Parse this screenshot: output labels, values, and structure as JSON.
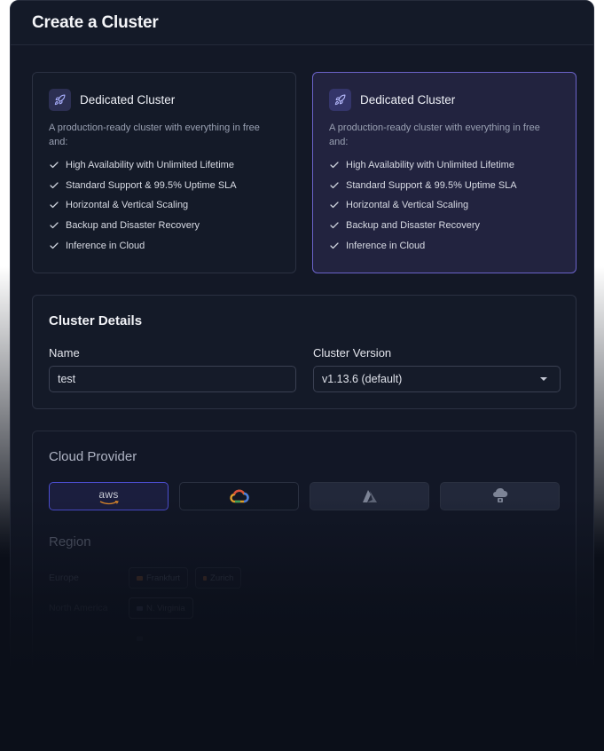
{
  "page": {
    "title": "Create a Cluster"
  },
  "plans": [
    {
      "name": "Dedicated Cluster",
      "description": "A production-ready cluster with everything in free and:",
      "features": [
        "High Availability with Unlimited Lifetime",
        "Standard Support & 99.5% Uptime SLA",
        "Horizontal & Vertical Scaling",
        "Backup and Disaster Recovery",
        "Inference in Cloud"
      ],
      "selected": false
    },
    {
      "name": "Dedicated Cluster",
      "description": "A production-ready cluster with everything in free and:",
      "features": [
        "High Availability with Unlimited Lifetime",
        "Standard Support & 99.5% Uptime SLA",
        "Horizontal & Vertical Scaling",
        "Backup and Disaster Recovery",
        "Inference in Cloud"
      ],
      "selected": true
    }
  ],
  "details": {
    "title": "Cluster Details",
    "name_label": "Name",
    "name_value": "test",
    "version_label": "Cluster Version",
    "version_value": "v1.13.6 (default)"
  },
  "cloud": {
    "title": "Cloud Provider",
    "providers": [
      {
        "id": "aws",
        "label": "aws",
        "icon": "aws-logo-icon",
        "selected": true
      },
      {
        "id": "gcp",
        "icon": "google-cloud-logo-icon",
        "selected": false
      },
      {
        "id": "azure",
        "icon": "azure-logo-icon",
        "selected": false
      },
      {
        "id": "other",
        "icon": "hybrid-cloud-icon",
        "selected": false
      }
    ],
    "region_title": "Region",
    "regions": [
      {
        "label": "Europe",
        "options": [
          "Frankfurt",
          "Zurich"
        ]
      },
      {
        "label": "North America",
        "options": [
          "N. Virginia"
        ]
      },
      {
        "label": "",
        "options": [
          ""
        ]
      }
    ]
  },
  "colors": {
    "accent": "#4c4ed0",
    "selected_card_border": "#6b63c9",
    "background": "#131826"
  }
}
